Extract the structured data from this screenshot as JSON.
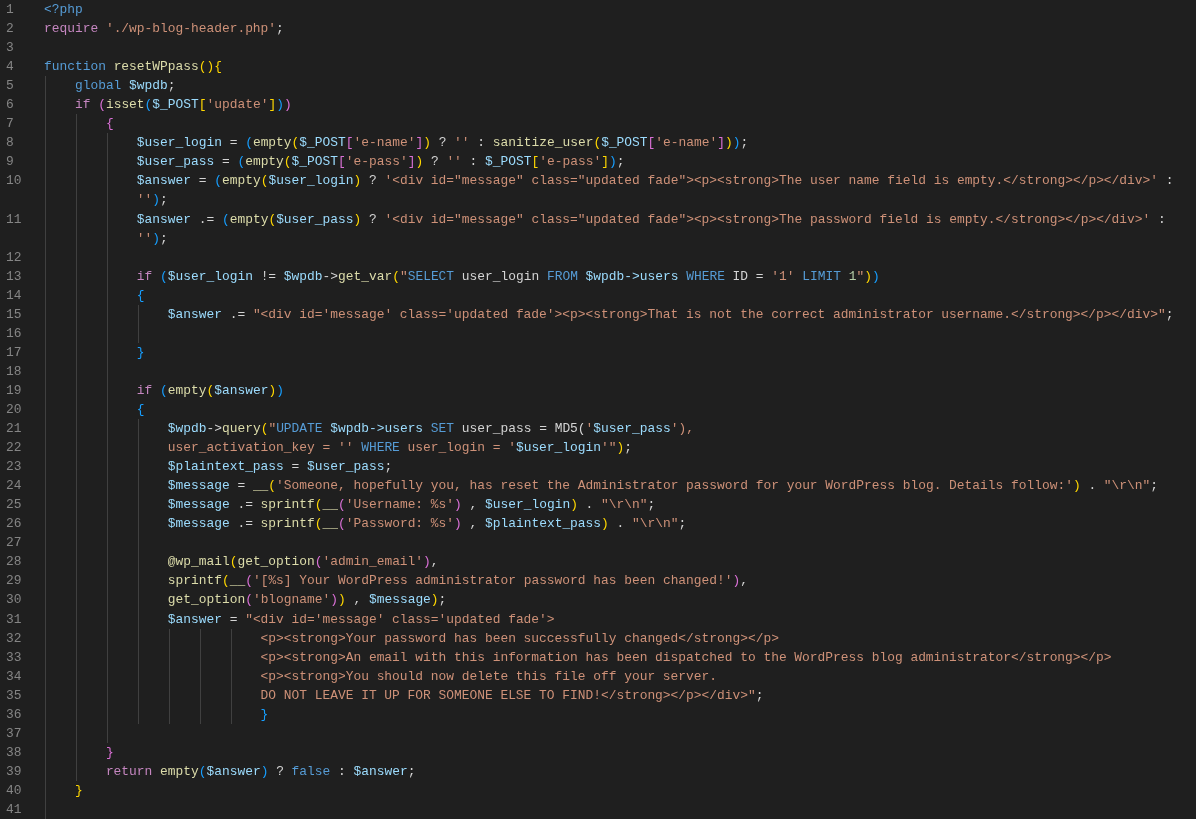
{
  "editor": {
    "lines": [
      {
        "number": "1",
        "tokens": [
          {
            "text": "<?php",
            "kind": "tag"
          }
        ]
      },
      {
        "number": "2",
        "tokens": [
          {
            "text": "require ",
            "kind": "kw"
          },
          {
            "text": "'./wp-blog-header.php'",
            "kind": "str"
          },
          {
            "text": ";",
            "kind": "op"
          }
        ]
      },
      {
        "number": "3"
      },
      {
        "number": "4",
        "tokens": [
          {
            "text": "function ",
            "kind": "storage"
          },
          {
            "text": "resetWPpass",
            "kind": "fn"
          },
          {
            "text": "(",
            "kind": "b1"
          },
          {
            "text": ")",
            "kind": "b1"
          },
          {
            "text": "{",
            "kind": "b1"
          }
        ]
      },
      {
        "number": "5",
        "tokens": [
          {
            "text": "    global ",
            "kind": "storage"
          },
          {
            "text": "$wpdb",
            "kind": "var"
          },
          {
            "text": ";",
            "kind": "op"
          }
        ]
      },
      {
        "number": "6",
        "tokens": [
          {
            "text": "    if ",
            "kind": "kw"
          },
          {
            "text": "(",
            "kind": "b2"
          },
          {
            "text": "isset",
            "kind": "fn"
          },
          {
            "text": "(",
            "kind": "b3"
          },
          {
            "text": "$_POST",
            "kind": "var"
          },
          {
            "text": "[",
            "kind": "b1"
          },
          {
            "text": "'update'",
            "kind": "str"
          },
          {
            "text": "]",
            "kind": "b1"
          },
          {
            "text": ")",
            "kind": "b3"
          },
          {
            "text": ")",
            "kind": "b2"
          }
        ]
      },
      {
        "number": "7",
        "tokens": [
          {
            "text": "        {",
            "kind": "b2"
          }
        ]
      },
      {
        "number": "8",
        "tokens": [
          {
            "text": "            $user_login",
            "kind": "var"
          },
          {
            "text": " = ",
            "kind": "op"
          },
          {
            "text": "(",
            "kind": "b3"
          },
          {
            "text": "empty",
            "kind": "fn"
          },
          {
            "text": "(",
            "kind": "b1"
          },
          {
            "text": "$_POST",
            "kind": "var"
          },
          {
            "text": "[",
            "kind": "b2"
          },
          {
            "text": "'e-name'",
            "kind": "str"
          },
          {
            "text": "]",
            "kind": "b2"
          },
          {
            "text": ")",
            "kind": "b1"
          },
          {
            "text": " ? ",
            "kind": "op"
          },
          {
            "text": "''",
            "kind": "str"
          },
          {
            "text": " : ",
            "kind": "op"
          },
          {
            "text": "sanitize_user",
            "kind": "fn"
          },
          {
            "text": "(",
            "kind": "b1"
          },
          {
            "text": "$_POST",
            "kind": "var"
          },
          {
            "text": "[",
            "kind": "b2"
          },
          {
            "text": "'e-name'",
            "kind": "str"
          },
          {
            "text": "]",
            "kind": "b2"
          },
          {
            "text": ")",
            "kind": "b1"
          },
          {
            "text": ")",
            "kind": "b3"
          },
          {
            "text": ";",
            "kind": "op"
          }
        ]
      },
      {
        "number": "9",
        "tokens": [
          {
            "text": "            $user_pass",
            "kind": "var"
          },
          {
            "text": " = ",
            "kind": "op"
          },
          {
            "text": "(",
            "kind": "b3"
          },
          {
            "text": "empty",
            "kind": "fn"
          },
          {
            "text": "(",
            "kind": "b1"
          },
          {
            "text": "$_POST",
            "kind": "var"
          },
          {
            "text": "[",
            "kind": "b2"
          },
          {
            "text": "'e-pass'",
            "kind": "str"
          },
          {
            "text": "]",
            "kind": "b2"
          },
          {
            "text": ")",
            "kind": "b1"
          },
          {
            "text": " ? ",
            "kind": "op"
          },
          {
            "text": "''",
            "kind": "str"
          },
          {
            "text": " : ",
            "kind": "op"
          },
          {
            "text": "$_POST",
            "kind": "var"
          },
          {
            "text": "[",
            "kind": "b1"
          },
          {
            "text": "'e-pass'",
            "kind": "str"
          },
          {
            "text": "]",
            "kind": "b1"
          },
          {
            "text": ")",
            "kind": "b3"
          },
          {
            "text": ";",
            "kind": "op"
          }
        ]
      },
      {
        "number": "10",
        "tokens": [
          {
            "text": "            $answer",
            "kind": "var"
          },
          {
            "text": " = ",
            "kind": "op"
          },
          {
            "text": "(",
            "kind": "b3"
          },
          {
            "text": "empty",
            "kind": "fn"
          },
          {
            "text": "(",
            "kind": "b1"
          },
          {
            "text": "$user_login",
            "kind": "var"
          },
          {
            "text": ")",
            "kind": "b1"
          },
          {
            "text": " ? ",
            "kind": "op"
          },
          {
            "text": "'<div id=\"message\" class=\"updated fade\"><p><strong>The user name field is empty.</strong></p></div>'",
            "kind": "str"
          },
          {
            "text": " :",
            "kind": "op"
          }
        ],
        "wrap": [
          {
            "text": "''",
            "kind": "str"
          },
          {
            "text": ")",
            "kind": "b3"
          },
          {
            "text": ";",
            "kind": "op"
          }
        ]
      },
      {
        "number": "11",
        "tokens": [
          {
            "text": "            $answer",
            "kind": "var"
          },
          {
            "text": " .= ",
            "kind": "op"
          },
          {
            "text": "(",
            "kind": "b3"
          },
          {
            "text": "empty",
            "kind": "fn"
          },
          {
            "text": "(",
            "kind": "b1"
          },
          {
            "text": "$user_pass",
            "kind": "var"
          },
          {
            "text": ")",
            "kind": "b1"
          },
          {
            "text": " ? ",
            "kind": "op"
          },
          {
            "text": "'<div id=\"message\" class=\"updated fade\"><p><strong>The password field is empty.</strong></p></div>'",
            "kind": "str"
          },
          {
            "text": " :",
            "kind": "op"
          }
        ],
        "wrap": [
          {
            "text": "''",
            "kind": "str"
          },
          {
            "text": ")",
            "kind": "b3"
          },
          {
            "text": ";",
            "kind": "op"
          }
        ]
      },
      {
        "number": "12"
      },
      {
        "number": "13",
        "tokens": [
          {
            "text": "            if ",
            "kind": "kw"
          },
          {
            "text": "(",
            "kind": "b3"
          },
          {
            "text": "$user_login",
            "kind": "var"
          },
          {
            "text": " != ",
            "kind": "op"
          },
          {
            "text": "$wpdb",
            "kind": "var"
          },
          {
            "text": "->",
            "kind": "op"
          },
          {
            "text": "get_var",
            "kind": "fn"
          },
          {
            "text": "(",
            "kind": "b1"
          },
          {
            "text": "\"",
            "kind": "str"
          },
          {
            "text": "SELECT",
            "kind": "sql"
          },
          {
            "text": " user_login ",
            "kind": "op"
          },
          {
            "text": "FROM ",
            "kind": "sql"
          },
          {
            "text": "$wpdb->users ",
            "kind": "var"
          },
          {
            "text": "WHERE",
            "kind": "sql"
          },
          {
            "text": " ID = ",
            "kind": "op"
          },
          {
            "text": "'1' ",
            "kind": "str"
          },
          {
            "text": "LIMIT ",
            "kind": "sql"
          },
          {
            "text": "1",
            "kind": "num"
          },
          {
            "text": "\"",
            "kind": "str"
          },
          {
            "text": ")",
            "kind": "b1"
          },
          {
            "text": ")",
            "kind": "b3"
          }
        ]
      },
      {
        "number": "14",
        "tokens": [
          {
            "text": "            {",
            "kind": "b3"
          }
        ]
      },
      {
        "number": "15",
        "tokens": [
          {
            "text": "                $answer",
            "kind": "var"
          },
          {
            "text": " .= ",
            "kind": "op"
          },
          {
            "text": "\"<div id='message' class='updated fade'><p><strong>That is not the correct administrator username.</strong></p></div>\"",
            "kind": "str"
          },
          {
            "text": ";",
            "kind": "op"
          }
        ]
      },
      {
        "number": "16"
      },
      {
        "number": "17",
        "tokens": [
          {
            "text": "            }",
            "kind": "b3"
          }
        ]
      },
      {
        "number": "18"
      },
      {
        "number": "19",
        "tokens": [
          {
            "text": "            if ",
            "kind": "kw"
          },
          {
            "text": "(",
            "kind": "b3"
          },
          {
            "text": "empty",
            "kind": "fn"
          },
          {
            "text": "(",
            "kind": "b1"
          },
          {
            "text": "$answer",
            "kind": "var"
          },
          {
            "text": ")",
            "kind": "b1"
          },
          {
            "text": ")",
            "kind": "b3"
          }
        ]
      },
      {
        "number": "20",
        "tokens": [
          {
            "text": "            {",
            "kind": "b3"
          }
        ]
      },
      {
        "number": "21",
        "tokens": [
          {
            "text": "                $wpdb",
            "kind": "var"
          },
          {
            "text": "->",
            "kind": "op"
          },
          {
            "text": "query",
            "kind": "fn"
          },
          {
            "text": "(",
            "kind": "b1"
          },
          {
            "text": "\"",
            "kind": "str"
          },
          {
            "text": "UPDATE ",
            "kind": "sql"
          },
          {
            "text": "$wpdb->users ",
            "kind": "var"
          },
          {
            "text": "SET",
            "kind": "sql"
          },
          {
            "text": " user_pass = MD5(",
            "kind": "op"
          },
          {
            "text": "'",
            "kind": "str"
          },
          {
            "text": "$user_pass",
            "kind": "var"
          },
          {
            "text": "'),",
            "kind": "str"
          }
        ]
      },
      {
        "number": "22",
        "tokens": [
          {
            "text": "                user_activation_key = '' ",
            "kind": "str"
          },
          {
            "text": "WHERE",
            "kind": "sql"
          },
          {
            "text": " user_login = '",
            "kind": "str"
          },
          {
            "text": "$user_login",
            "kind": "var"
          },
          {
            "text": "'\"",
            "kind": "str"
          },
          {
            "text": ")",
            "kind": "b1"
          },
          {
            "text": ";",
            "kind": "op"
          }
        ]
      },
      {
        "number": "23",
        "tokens": [
          {
            "text": "                $plaintext_pass",
            "kind": "var"
          },
          {
            "text": " = ",
            "kind": "op"
          },
          {
            "text": "$user_pass",
            "kind": "var"
          },
          {
            "text": ";",
            "kind": "op"
          }
        ]
      },
      {
        "number": "24",
        "tokens": [
          {
            "text": "                $message",
            "kind": "var"
          },
          {
            "text": " = ",
            "kind": "op"
          },
          {
            "text": "__",
            "kind": "fn"
          },
          {
            "text": "(",
            "kind": "b1"
          },
          {
            "text": "'Someone, hopefully you, has reset the Administrator password for your WordPress blog. Details follow:'",
            "kind": "str"
          },
          {
            "text": ")",
            "kind": "b1"
          },
          {
            "text": " . ",
            "kind": "op"
          },
          {
            "text": "\"\\r\\n\"",
            "kind": "str"
          },
          {
            "text": ";",
            "kind": "op"
          }
        ]
      },
      {
        "number": "25",
        "tokens": [
          {
            "text": "                $message",
            "kind": "var"
          },
          {
            "text": " .= ",
            "kind": "op"
          },
          {
            "text": "sprintf",
            "kind": "fn"
          },
          {
            "text": "(",
            "kind": "b1"
          },
          {
            "text": "__",
            "kind": "fn"
          },
          {
            "text": "(",
            "kind": "b2"
          },
          {
            "text": "'Username: %s'",
            "kind": "str"
          },
          {
            "text": ")",
            "kind": "b2"
          },
          {
            "text": " , ",
            "kind": "op"
          },
          {
            "text": "$user_login",
            "kind": "var"
          },
          {
            "text": ")",
            "kind": "b1"
          },
          {
            "text": " . ",
            "kind": "op"
          },
          {
            "text": "\"\\r\\n\"",
            "kind": "str"
          },
          {
            "text": ";",
            "kind": "op"
          }
        ]
      },
      {
        "number": "26",
        "tokens": [
          {
            "text": "                $message",
            "kind": "var"
          },
          {
            "text": " .= ",
            "kind": "op"
          },
          {
            "text": "sprintf",
            "kind": "fn"
          },
          {
            "text": "(",
            "kind": "b1"
          },
          {
            "text": "__",
            "kind": "fn"
          },
          {
            "text": "(",
            "kind": "b2"
          },
          {
            "text": "'Password: %s'",
            "kind": "str"
          },
          {
            "text": ")",
            "kind": "b2"
          },
          {
            "text": " , ",
            "kind": "op"
          },
          {
            "text": "$plaintext_pass",
            "kind": "var"
          },
          {
            "text": ")",
            "kind": "b1"
          },
          {
            "text": " . ",
            "kind": "op"
          },
          {
            "text": "\"\\r\\n\"",
            "kind": "str"
          },
          {
            "text": ";",
            "kind": "op"
          }
        ]
      },
      {
        "number": "27"
      },
      {
        "number": "28",
        "tokens": [
          {
            "text": "                @wp_mail",
            "kind": "fn"
          },
          {
            "text": "(",
            "kind": "b1"
          },
          {
            "text": "get_option",
            "kind": "fn"
          },
          {
            "text": "(",
            "kind": "b2"
          },
          {
            "text": "'admin_email'",
            "kind": "str"
          },
          {
            "text": ")",
            "kind": "b2"
          },
          {
            "text": ",",
            "kind": "op"
          }
        ]
      },
      {
        "number": "29",
        "tokens": [
          {
            "text": "                sprintf",
            "kind": "fn"
          },
          {
            "text": "(",
            "kind": "b1"
          },
          {
            "text": "__",
            "kind": "fn"
          },
          {
            "text": "(",
            "kind": "b2"
          },
          {
            "text": "'[%s] Your WordPress administrator password has been changed!'",
            "kind": "str"
          },
          {
            "text": ")",
            "kind": "b2"
          },
          {
            "text": ",",
            "kind": "op"
          }
        ]
      },
      {
        "number": "30",
        "tokens": [
          {
            "text": "                get_option",
            "kind": "fn"
          },
          {
            "text": "(",
            "kind": "b2"
          },
          {
            "text": "'blogname'",
            "kind": "str"
          },
          {
            "text": ")",
            "kind": "b2"
          },
          {
            "text": ")",
            "kind": "b1"
          },
          {
            "text": " , ",
            "kind": "op"
          },
          {
            "text": "$message",
            "kind": "var"
          },
          {
            "text": ")",
            "kind": "b1"
          },
          {
            "text": ";",
            "kind": "op"
          }
        ]
      },
      {
        "number": "31",
        "tokens": [
          {
            "text": "                $answer",
            "kind": "var"
          },
          {
            "text": " = ",
            "kind": "op"
          },
          {
            "text": "\"<div id='message' class='updated fade'>",
            "kind": "str"
          }
        ]
      },
      {
        "number": "32",
        "tokens": [
          {
            "text": "                            <p><strong>Your password has been successfully changed</strong></p>",
            "kind": "str"
          }
        ]
      },
      {
        "number": "33",
        "tokens": [
          {
            "text": "                            <p><strong>An email with this information has been dispatched to the WordPress blog administrator</strong></p>",
            "kind": "str"
          }
        ]
      },
      {
        "number": "34",
        "tokens": [
          {
            "text": "                            <p><strong>You should now delete this file off your server.",
            "kind": "str"
          }
        ]
      },
      {
        "number": "35",
        "tokens": [
          {
            "text": "                            DO NOT LEAVE IT UP FOR SOMEONE ELSE TO FIND!</strong></p></div>\"",
            "kind": "str"
          },
          {
            "text": ";",
            "kind": "op"
          }
        ]
      },
      {
        "number": "36",
        "tokens": [
          {
            "text": "                            }",
            "kind": "b3"
          }
        ]
      },
      {
        "number": "37"
      },
      {
        "number": "38",
        "tokens": [
          {
            "text": "        }",
            "kind": "b2"
          }
        ]
      },
      {
        "number": "39",
        "tokens": [
          {
            "text": "        return ",
            "kind": "kw"
          },
          {
            "text": "empty",
            "kind": "fn"
          },
          {
            "text": "(",
            "kind": "b3"
          },
          {
            "text": "$answer",
            "kind": "var"
          },
          {
            "text": ")",
            "kind": "b3"
          },
          {
            "text": " ? ",
            "kind": "op"
          },
          {
            "text": "false",
            "kind": "const"
          },
          {
            "text": " : ",
            "kind": "op"
          },
          {
            "text": "$answer",
            "kind": "var"
          },
          {
            "text": ";",
            "kind": "op"
          }
        ]
      },
      {
        "number": "40",
        "tokens": [
          {
            "text": "    }",
            "kind": "b1"
          }
        ]
      },
      {
        "number": "41"
      }
    ]
  }
}
